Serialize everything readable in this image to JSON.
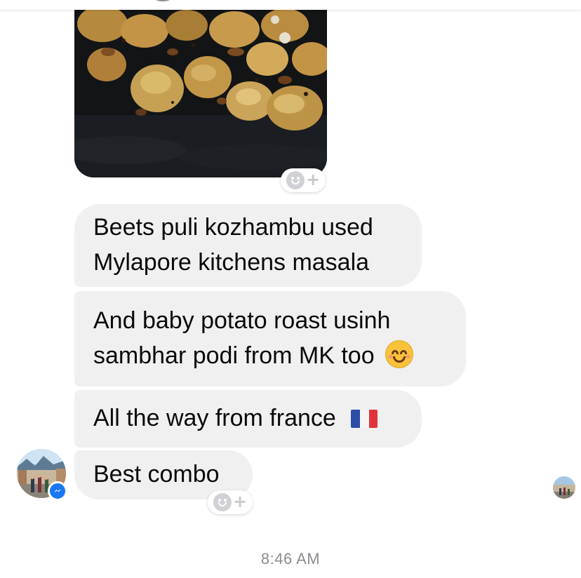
{
  "thread": {
    "messages": [
      {
        "lines": [
          "Beets puli kozhambu used",
          "Mylapore kitchens masala"
        ]
      },
      {
        "lines": [
          "And baby potato roast usinh",
          "sambhar podi from MK too"
        ],
        "trailing_emoji": "smiling-face-emoji"
      },
      {
        "lines": [
          "All the way from france"
        ],
        "trailing_emoji": "france-flag-emoji"
      },
      {
        "lines": [
          "Best combo"
        ]
      }
    ],
    "timestamp": "8:46 AM"
  },
  "icons": {
    "reaction_add": "add-reaction-icon",
    "messenger_badge": "messenger-icon",
    "sender_avatar": "avatar",
    "seen_indicator": "seen-avatar"
  },
  "colors": {
    "bubble_bg": "#f0f0f0",
    "text": "#0a0a0a",
    "timestamp": "#8a8d91",
    "messenger_blue": "#1877f2",
    "reaction_icon": "#cfd1d4"
  }
}
